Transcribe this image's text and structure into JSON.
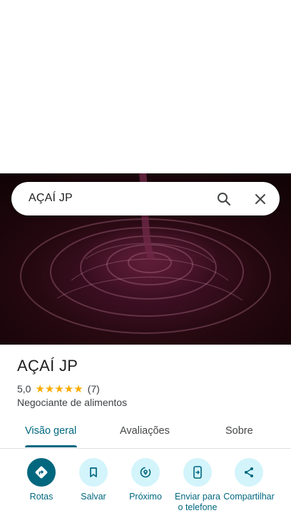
{
  "search": {
    "query": "AÇAÍ JP"
  },
  "place": {
    "name": "AÇAÍ JP",
    "rating": "5,0",
    "stars": "★★★★★",
    "review_count": "(7)",
    "category": "Negociante de alimentos"
  },
  "tabs": [
    {
      "label": "Visão geral",
      "selected": true
    },
    {
      "label": "Avaliações",
      "selected": false
    },
    {
      "label": "Sobre",
      "selected": false
    }
  ],
  "actions": [
    {
      "label": "Rotas",
      "icon": "directions-icon"
    },
    {
      "label": "Salvar",
      "icon": "bookmark-icon"
    },
    {
      "label": "Próximo",
      "icon": "nearby-icon"
    },
    {
      "label": "Enviar para o telefone",
      "icon": "send-to-phone-icon"
    },
    {
      "label": "Compartilhar",
      "icon": "share-icon"
    }
  ],
  "colors": {
    "accent": "#00677f",
    "accent_light": "#d3f4fb",
    "star": "#f9ab00"
  }
}
